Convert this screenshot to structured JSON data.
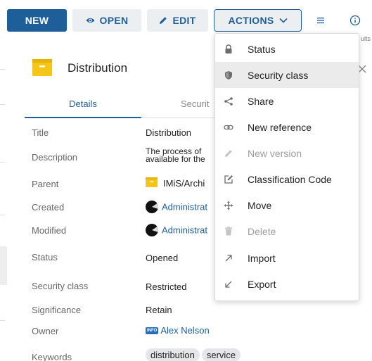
{
  "toolbar": {
    "new_label": "NEW",
    "open_label": "OPEN",
    "edit_label": "EDIT",
    "actions_label": "ACTIONS",
    "cut_text": "ults"
  },
  "detail": {
    "title": "Distribution",
    "tabs": [
      {
        "label": "Details"
      },
      {
        "label": "Securit"
      }
    ],
    "properties": {
      "title": {
        "label": "Title",
        "value": "Distribution"
      },
      "description": {
        "label": "Description",
        "line1": "The process of",
        "line2": "available for the"
      },
      "parent": {
        "label": "Parent",
        "value": "IMiS/Archi"
      },
      "created": {
        "label": "Created",
        "value": "Administrat"
      },
      "modified": {
        "label": "Modified",
        "value": "Administrat"
      },
      "status": {
        "label": "Status",
        "value": "Opened"
      },
      "security_class": {
        "label": "Security class",
        "value": "Restricted"
      },
      "significance": {
        "label": "Significance",
        "value": "Retain"
      },
      "owner": {
        "label": "Owner",
        "badge": "INFO",
        "value": "Alex Nelson"
      },
      "keywords": {
        "label": "Keywords",
        "chips": [
          "distribution",
          "service"
        ]
      }
    }
  },
  "actions_menu": {
    "items": [
      {
        "label": "Status",
        "icon": "lock-icon",
        "disabled": false,
        "highlighted": false
      },
      {
        "label": "Security class",
        "icon": "shield-icon",
        "disabled": false,
        "highlighted": true
      },
      {
        "label": "Share",
        "icon": "share-icon",
        "disabled": false,
        "highlighted": false
      },
      {
        "label": "New reference",
        "icon": "link-icon",
        "disabled": false,
        "highlighted": false
      },
      {
        "label": "New version",
        "icon": "pencil-icon",
        "disabled": true,
        "highlighted": false
      },
      {
        "label": "Classification Code",
        "icon": "edit-box-icon",
        "disabled": false,
        "highlighted": false
      },
      {
        "label": "Move",
        "icon": "move-icon",
        "disabled": false,
        "highlighted": false
      },
      {
        "label": "Delete",
        "icon": "trash-icon",
        "disabled": true,
        "highlighted": false
      },
      {
        "label": "Import",
        "icon": "arrow-up-right-icon",
        "disabled": false,
        "highlighted": false
      },
      {
        "label": "Export",
        "icon": "arrow-down-left-icon",
        "disabled": false,
        "highlighted": false
      }
    ]
  },
  "colors": {
    "primary": "#1f5f99",
    "folder": "#f5c518",
    "menu_highlight": "#ebebeb",
    "disabled_text": "#9e9e9e"
  }
}
